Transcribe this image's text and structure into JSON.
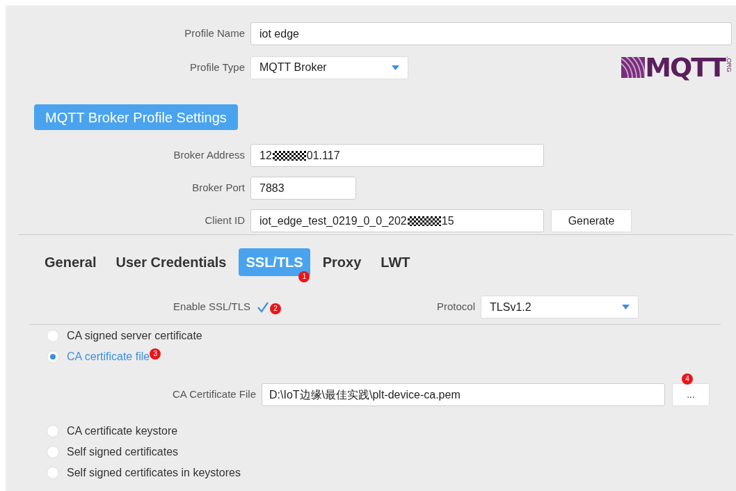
{
  "profile": {
    "name_label": "Profile Name",
    "name_value": "iot edge",
    "type_label": "Profile Type",
    "type_value": "MQTT Broker"
  },
  "logo": {
    "text": "MQTT",
    "suffix": ".ORG"
  },
  "section_button": "MQTT Broker Profile Settings",
  "broker": [
    {
      "label": "Broker Address",
      "value_parts": [
        "12",
        "01.117"
      ],
      "redacted": true,
      "kind": "wide"
    },
    {
      "label": "Broker Port",
      "value_parts": [
        "7883"
      ],
      "redacted": false,
      "kind": "short"
    },
    {
      "label": "Client ID",
      "value_parts": [
        "iot_edge_test_0219_0_0_202",
        "15"
      ],
      "redacted": true,
      "kind": "wide"
    }
  ],
  "generate_button": "Generate",
  "tabs": [
    {
      "label": "General",
      "selected": false
    },
    {
      "label": "User Credentials",
      "selected": false
    },
    {
      "label": "SSL/TLS",
      "selected": true,
      "badge": "1"
    },
    {
      "label": "Proxy",
      "selected": false
    },
    {
      "label": "LWT",
      "selected": false
    }
  ],
  "ssl": {
    "enable_label": "Enable SSL/TLS",
    "checked": true,
    "badge": "2",
    "protocol_label": "Protocol",
    "protocol_value": "TLSv1.2"
  },
  "options": [
    {
      "label": "CA signed server certificate",
      "selected": false
    },
    {
      "label": "CA certificate file",
      "selected": true,
      "badge": "3"
    },
    {
      "label": "CA certificate keystore",
      "selected": false
    },
    {
      "label": "Self signed certificates",
      "selected": false
    },
    {
      "label": "Self signed certificates in keystores",
      "selected": false
    }
  ],
  "ca_file": {
    "label": "CA Certificate File",
    "value": "D:\\IoT边缘\\最佳实践\\plt-device-ca.pem",
    "browse_button": "...",
    "badge": "4"
  }
}
